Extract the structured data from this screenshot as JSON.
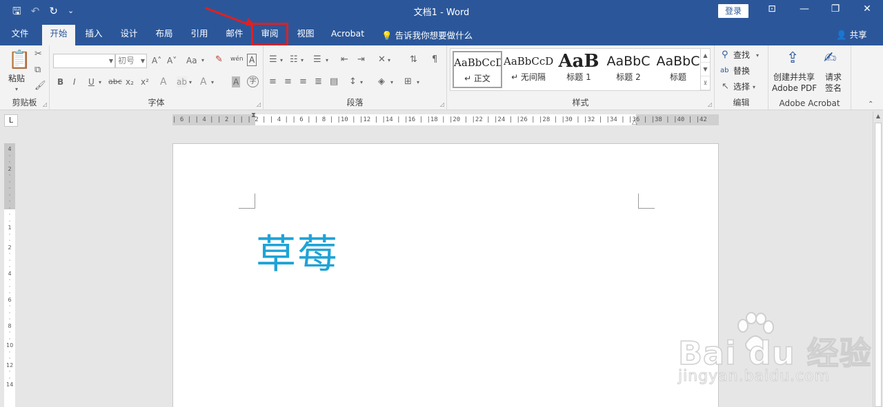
{
  "titlebar": {
    "doc_title": "文档1  -  Word",
    "login": "登录",
    "qat": {
      "save": "🖫",
      "undo": "↶",
      "redo": "↻",
      "customize": "⌄"
    },
    "controls": {
      "ribbon_display": "⊡",
      "minimize": "—",
      "restore": "❐",
      "close": "✕"
    }
  },
  "tabs": {
    "file": "文件",
    "home": "开始",
    "insert": "插入",
    "design": "设计",
    "layout": "布局",
    "references": "引用",
    "mailings": "邮件",
    "review": "审阅",
    "view": "视图",
    "acrobat": "Acrobat",
    "tell_me": "告诉我你想要做什么",
    "share": "共享"
  },
  "clipboard": {
    "paste": "粘贴",
    "label": "剪贴板"
  },
  "font": {
    "font_name": "",
    "font_size": "初号",
    "label": "字体",
    "bold": "B",
    "italic": "I",
    "underline": "U",
    "strike": "abc",
    "sub": "x₂",
    "sup": "x²",
    "grow": "A˄",
    "shrink": "A˅",
    "case": "Aa",
    "clear": "A",
    "phonetic": "wén",
    "border": "A",
    "effects": "A",
    "highlight": "ab",
    "color": "A",
    "shade": "A",
    "enclose": "字"
  },
  "paragraph": {
    "label": "段落"
  },
  "styles": {
    "label": "样式",
    "items": [
      {
        "preview": "AaBbCcDd",
        "name": "↵ 正文"
      },
      {
        "preview": "AaBbCcDd",
        "name": "↵ 无间隔"
      },
      {
        "preview": "AaB",
        "name": "标题 1"
      },
      {
        "preview": "AaBbC",
        "name": "标题 2"
      },
      {
        "preview": "AaBbC",
        "name": "标题"
      }
    ]
  },
  "editing": {
    "find": "查找",
    "replace": "替换",
    "select": "选择",
    "label": "编辑"
  },
  "acrobat_group": {
    "create_share_line1": "创建并共享",
    "create_share_line2": "Adobe PDF",
    "sign_line1": "请求",
    "sign_line2": "签名",
    "label": "Adobe Acrobat"
  },
  "ruler": {
    "corner": "L",
    "h_ticks": "| 6 |   | 4 |   | 2 |   |   | 2 |   | 4 |   | 6 |   | 8 |   |10 |   |12 |   |14 |   |16 |   |18 |   |20 |   |22 |   |24 |   |26 |   |28 |   |30 |   |32 |   |34 |   |36 |   |38 |   |40 |   |42",
    "v_ticks": [
      "4",
      "·",
      "·",
      "2",
      "·",
      "·",
      "·",
      "·",
      "·",
      "·",
      "·",
      "·",
      "1",
      "·",
      "·",
      "2",
      "·",
      "·",
      "·",
      "4",
      "·",
      "·",
      "·",
      "6",
      "·",
      "·",
      "·",
      "8",
      "·",
      "·",
      "10",
      "·",
      "·",
      "12",
      "·",
      "·",
      "14"
    ]
  },
  "document": {
    "text": "草莓"
  },
  "watermark": {
    "logo": "Bai  du 经验",
    "url": "jingyan.baidu.com"
  },
  "colors": {
    "brand": "#2b579a",
    "highlight_box": "#e02020",
    "doc_text": "#1fa3d6"
  }
}
